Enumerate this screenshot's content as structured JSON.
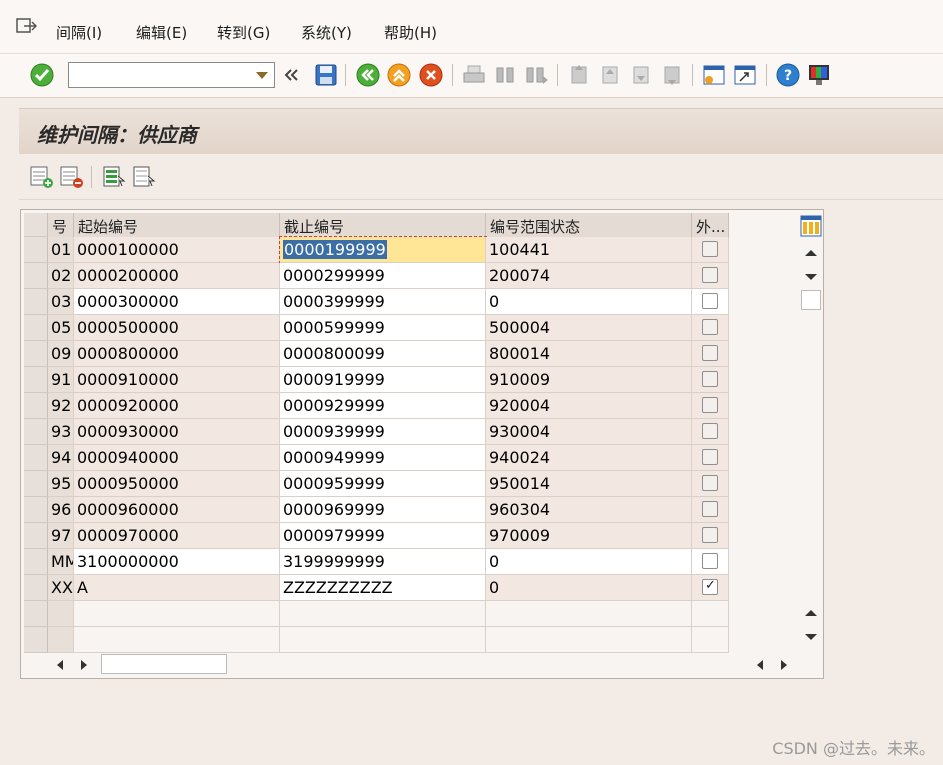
{
  "menu": {
    "items": [
      "间隔(I)",
      "编辑(E)",
      "转到(G)",
      "系统(Y)",
      "帮助(H)"
    ]
  },
  "toolbar": {
    "command_value": ""
  },
  "title": "维护间隔：供应商",
  "table": {
    "headers": {
      "no": "号",
      "start": "起始编号",
      "end": "截止编号",
      "status": "编号范围状态",
      "ext": "外..."
    },
    "rows": [
      {
        "no": "01",
        "start": "0000100000",
        "end": "0000199999",
        "status": "100441",
        "ext": false
      },
      {
        "no": "02",
        "start": "0000200000",
        "end": "0000299999",
        "status": "200074",
        "ext": false
      },
      {
        "no": "03",
        "start": "0000300000",
        "end": "0000399999",
        "status": "0",
        "ext": false
      },
      {
        "no": "05",
        "start": "0000500000",
        "end": "0000599999",
        "status": "500004",
        "ext": false
      },
      {
        "no": "09",
        "start": "0000800000",
        "end": "0000800099",
        "status": "800014",
        "ext": false
      },
      {
        "no": "91",
        "start": "0000910000",
        "end": "0000919999",
        "status": "910009",
        "ext": false
      },
      {
        "no": "92",
        "start": "0000920000",
        "end": "0000929999",
        "status": "920004",
        "ext": false
      },
      {
        "no": "93",
        "start": "0000930000",
        "end": "0000939999",
        "status": "930004",
        "ext": false
      },
      {
        "no": "94",
        "start": "0000940000",
        "end": "0000949999",
        "status": "940024",
        "ext": false
      },
      {
        "no": "95",
        "start": "0000950000",
        "end": "0000959999",
        "status": "950014",
        "ext": false
      },
      {
        "no": "96",
        "start": "0000960000",
        "end": "0000969999",
        "status": "960304",
        "ext": false
      },
      {
        "no": "97",
        "start": "0000970000",
        "end": "0000979999",
        "status": "970009",
        "ext": false
      },
      {
        "no": "MM",
        "start": "3100000000",
        "end": "3199999999",
        "status": "0",
        "ext": false
      },
      {
        "no": "XX",
        "start": "A",
        "end": "ZZZZZZZZZZ",
        "status": "0",
        "ext": true
      }
    ]
  },
  "watermark": "CSDN @过去。未来。"
}
